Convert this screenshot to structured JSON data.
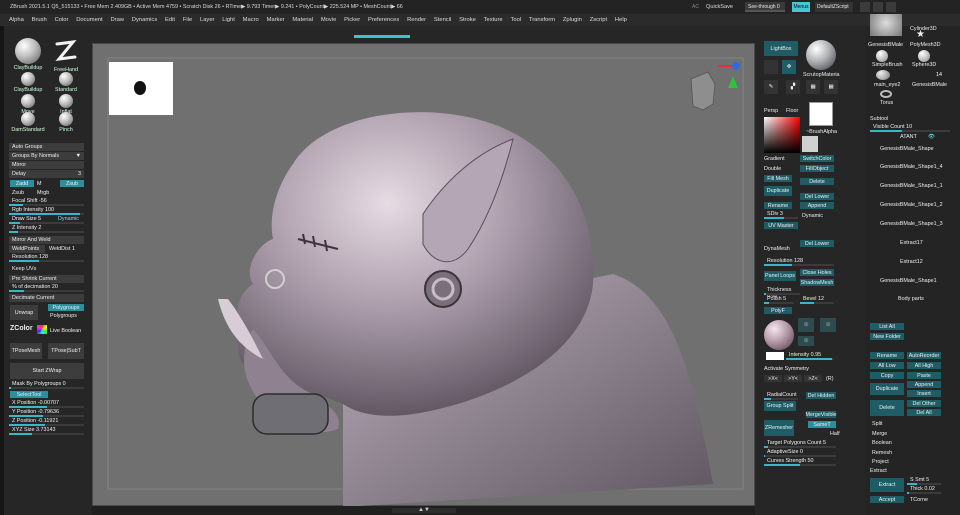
{
  "titlebar": {
    "title": "ZBrush 2021.5.1   Q5_515133   • Free Mem 2.409GB • Active Mem 4759 • Scratch Disk 26 • RTime▶ 9.793 Timer▶ 9.241 • PolyCount▶ 225.524 MP • MeshCount▶ 66",
    "ac": "AC",
    "quicksave": "QuickSave",
    "seethrough": "See-through  0",
    "menus": "Menus",
    "default_script": "DefaultZScript"
  },
  "menubar": [
    "Alpha",
    "Brush",
    "Color",
    "Document",
    "Draw",
    "Dynamics",
    "Edit",
    "File",
    "Layer",
    "Light",
    "Macro",
    "Marker",
    "Material",
    "Movie",
    "Picker",
    "Preferences",
    "Render",
    "Stencil",
    "Stroke",
    "Texture",
    "Tool",
    "Transform",
    "Zplugin",
    "Zscript",
    "Help"
  ],
  "left": {
    "brushes": [
      "ClayBuildup",
      "FreeHand",
      "ClayBuildup",
      "Standard",
      "Move",
      "Inflat",
      "DamStandard",
      "Pinch"
    ],
    "auto_groups": "Auto Groups",
    "groups_by_normals": "Groups By Normals",
    "mirror": "Mirror",
    "delay": "Delay",
    "delay_value": "3",
    "zadd": "Zadd",
    "m": "M",
    "zsub": "Zsub",
    "zsub2": "Zsub",
    "mrgb": "Mrgb",
    "focal_shift": "Focal Shift -56",
    "rgb_intensity": "Rgb Intensity 100",
    "draw_size": "Draw Size 5",
    "dynamic": "Dynamic",
    "z_intensity": "Z Intensity 2",
    "mirror_and_weld": "Mirror And Weld",
    "weld_points": "WeldPoints",
    "weld_dist": "WeldDist 1",
    "resolution": "Resolution 128",
    "keep_uvs": "Keep UVs",
    "pre_shrink": "Pre Shrink Current",
    "pct_decimation": "% of decimation 20",
    "decimate_current": "Decimate Current",
    "unwrap": "Unwrap",
    "polygroups_top": "Polygroups",
    "polygroups": "Polygroups",
    "zcolor": "ZColor",
    "live_boolean": "Live Boolean",
    "tpose_mesh": "TPoseMesh",
    "tpose_subt": "TPose|SubT",
    "start_zwrap": "Start ZWrap",
    "mask_by_polygroups": "Mask By Polygroups 0",
    "sel_tool": "SelectTool",
    "x_position": "X Position -0.00707",
    "y_position": "Y Position -0.79636",
    "z_position": "Z Position -0.11921",
    "xyz_size": "XYZ Size 3.73143"
  },
  "shelf": {
    "lightbox": "LightBox",
    "scrutop": "ScrutopMateria",
    "persp": "Persp",
    "floor": "Floor",
    "alpha": "~BrushAlpha",
    "gradient": "Gradient",
    "switchcolor": "SwitchColor",
    "double": "Double",
    "fillobject": "FillObject",
    "fill_mesh": "Fill Mesh",
    "delete": "Delete",
    "duplicate": "Duplicate",
    "del_lower": "Del Lower",
    "rename": "Rename",
    "append": "Append",
    "sdiv": "SDiv 3",
    "dynamic": "Dynamic",
    "uv_master": "UV Master",
    "del_higher": "Del Lower",
    "dynamesh": "DynaMesh",
    "resolution": "Resolution 128",
    "panel_loops": "Panel Loops",
    "close_holes": "Close Holes",
    "shadow_mesh": "ShadowMesh",
    "thickness": "Thickness 0.01",
    "polish": "Polish 5",
    "bevel": "Bevel 12",
    "poly_fill": "PolyF",
    "intensity": "Intensity 0.95",
    "activate_symmetry": "Activate Symmetry",
    "sym_x": ">X<",
    "sym_y": ">Y<",
    "sym_z": ">Z<",
    "r": "(R)",
    "radialcount": "RadialCount",
    "del_hidden": "Del Hidden",
    "group_split": "Group Split",
    "mergevisible": "MergeVisible",
    "zremesher": "ZRemesher",
    "half": "Half",
    "same": "SameT",
    "target_polygons": "Target Polygons Count 5",
    "adaptive_size": "AdaptiveSize 0",
    "curves_strength": "Curves Strength 50"
  },
  "right": {
    "tools": [
      "Cylinder3D",
      "GenesisBMale",
      "PolyMesh3D",
      "SimpleBrush",
      "Sphere3D",
      "main_eye2",
      "GenesisBMale",
      "Torus"
    ],
    "tool_count": "14",
    "subtool": "Subtool",
    "visible_count": "Visible Count 10",
    "subtools": [
      "ATANT",
      "GenesisBMale_Shape",
      "GenesisBMale_Shape1_4",
      "GenesisBMale_Shape1_1",
      "GenesisBMale_Shape1_2",
      "GenesisBMale_Shape1_3",
      "Extract17",
      "Extract12",
      "GenesisBMale_Shape1"
    ],
    "body_parts": "Body parts",
    "list_all": "List All",
    "new_folder": "New Folder",
    "rename": "Rename",
    "auto_reorder": "AutoReorder",
    "all_low": "All Low",
    "all_high": "All High",
    "copy": "Copy",
    "paste": "Paste",
    "duplicate": "Duplicate",
    "append": "Append",
    "insert": "Insert",
    "delete": "Delete",
    "del_other": "Del Other",
    "del_all": "Del All",
    "split": "Split",
    "merge": "Merge",
    "boolean": "Boolean",
    "remesh": "Remesh",
    "project": "Project",
    "extract": "Extract",
    "extract_btn": "Extract",
    "s_smt": "S Smt 5",
    "thick": "Thick 0.02",
    "accept": "Accept",
    "tcorne": "TCorne"
  }
}
